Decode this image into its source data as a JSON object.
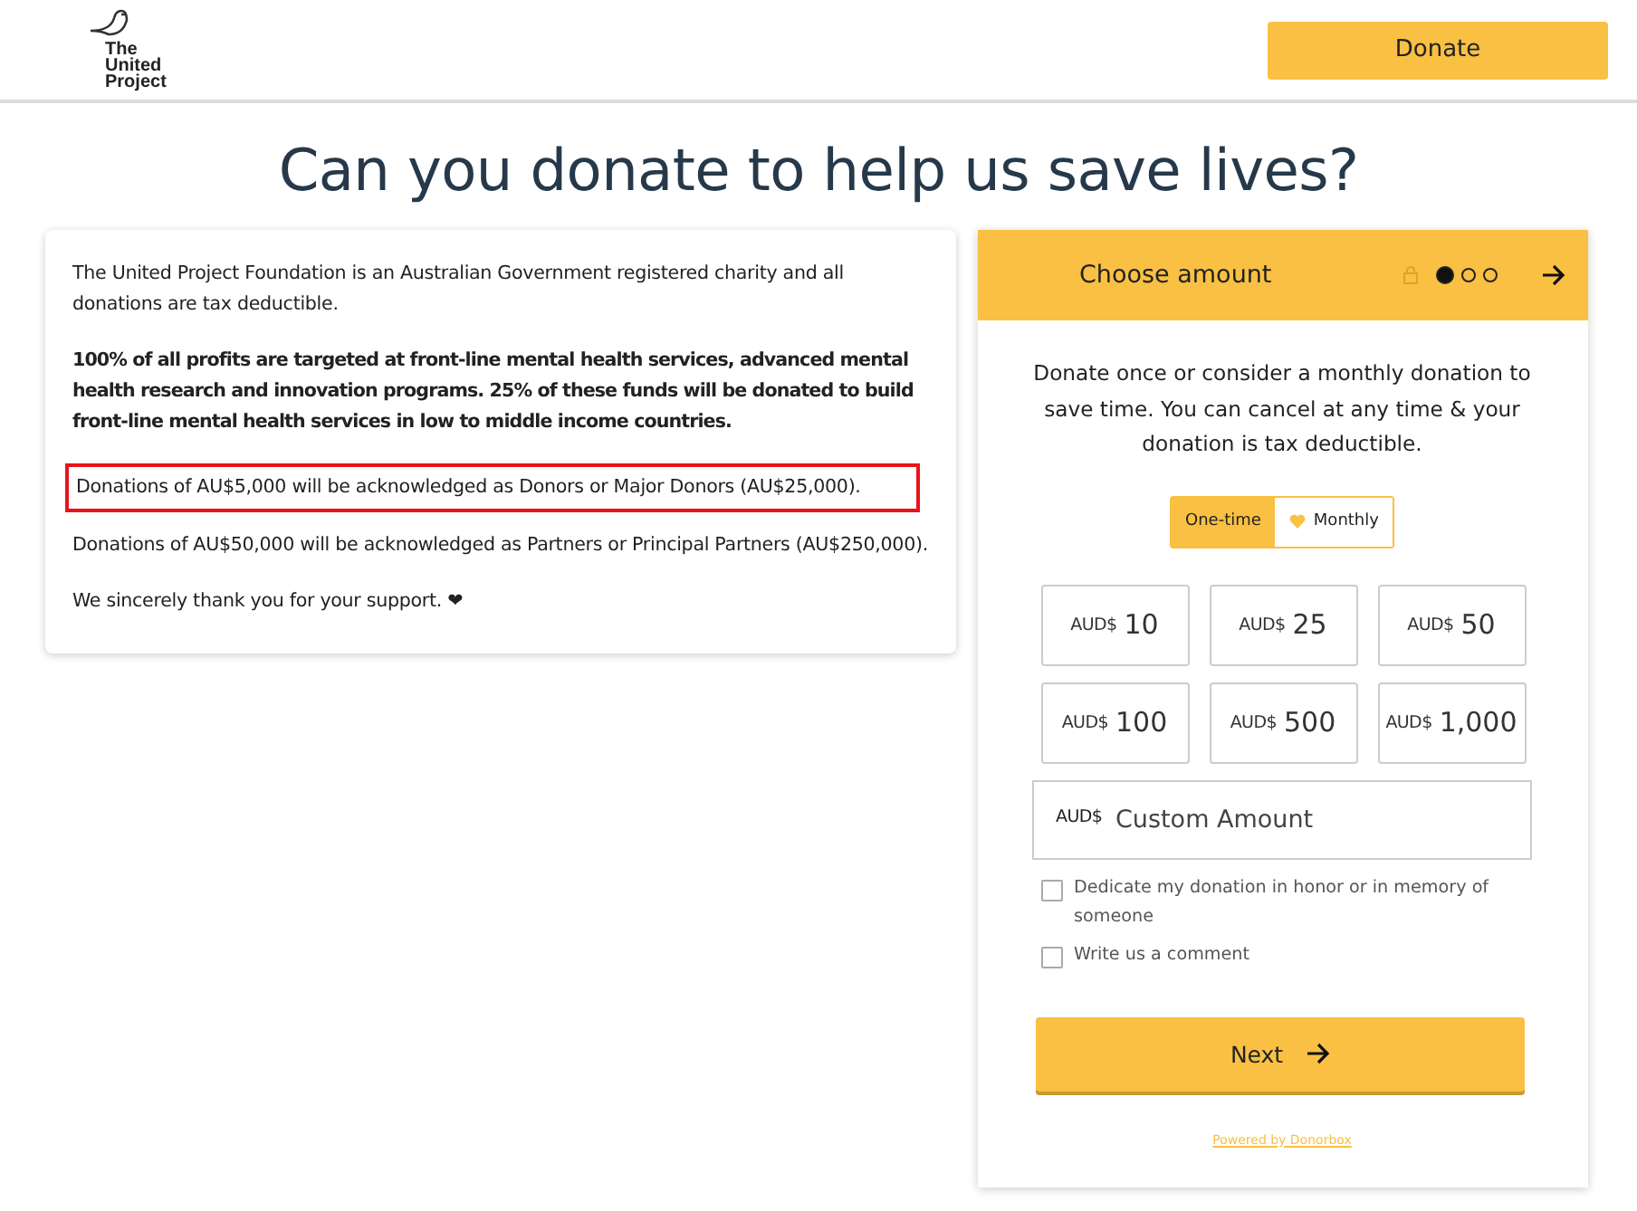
{
  "header": {
    "logo_text": "The United Project",
    "donate_button": "Donate"
  },
  "title": "Can you donate to help us save lives?",
  "info_card": {
    "paragraphs": [
      {
        "kind": "plain",
        "text": "The United Project Foundation is an Australian Government registered charity and all donations are tax deductible."
      },
      {
        "kind": "bold",
        "text": "100% of all profits are targeted at front-line mental health services, advanced mental health research and innovation programs. 25% of these funds will be donated to build front-line mental health services in low to middle income countries."
      },
      {
        "kind": "highlighted",
        "text": "Donations of AU$5,000 will be acknowledged as Donors or Major Donors (AU$25,000)."
      },
      {
        "kind": "plain",
        "text": "Donations of AU$50,000 will be acknowledged as Partners or Principal Partners (AU$250,000)."
      },
      {
        "kind": "plain",
        "text": "We sincerely thank you for your support. ❤"
      }
    ]
  },
  "donation_form": {
    "header": "Choose amount",
    "steps": [
      {
        "selected": true
      },
      {
        "selected": false
      },
      {
        "selected": false
      }
    ],
    "intro": "Donate once or consider a monthly donation to save time. You can cancel at any time & your donation is tax deductible.",
    "frequency": [
      {
        "label": "One-time",
        "selected": true
      },
      {
        "label": "Monthly",
        "selected": false
      }
    ],
    "amounts": [
      {
        "currency": "AUD$",
        "value": "10"
      },
      {
        "currency": "AUD$",
        "value": "25"
      },
      {
        "currency": "AUD$",
        "value": "50"
      },
      {
        "currency": "AUD$",
        "value": "100"
      },
      {
        "currency": "AUD$",
        "value": "500"
      },
      {
        "currency": "AUD$",
        "value": "1,000"
      }
    ],
    "custom_amount": {
      "currency": "AUD$",
      "placeholder": "Custom Amount"
    },
    "options": [
      {
        "label": "Dedicate my donation in honor or in memory of someone",
        "checked": false
      },
      {
        "label": "Write us a comment",
        "checked": false
      }
    ],
    "next_button": "Next",
    "powered_by": "Powered by Donorbox"
  }
}
